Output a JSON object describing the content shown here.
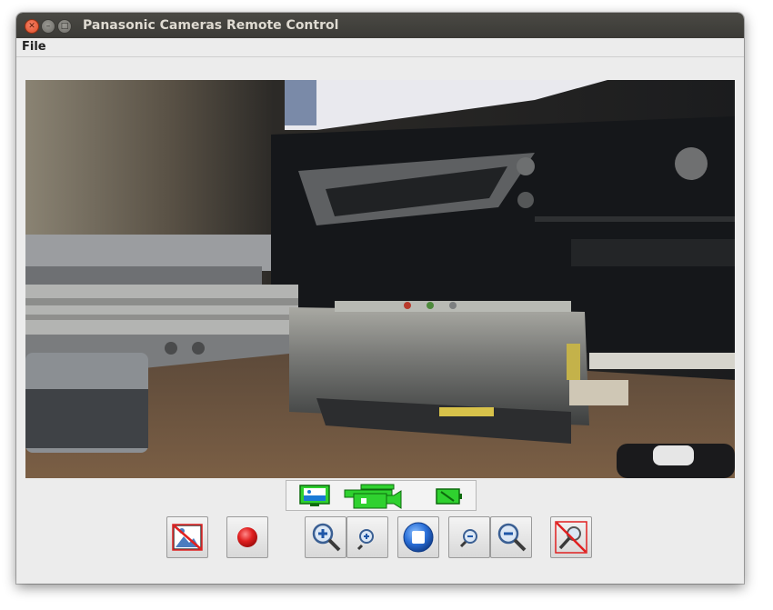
{
  "window": {
    "title": "Panasonic Cameras Remote Control"
  },
  "menu": {
    "file_label": "File"
  },
  "colors": {
    "accent_green": "#2fd12f",
    "record_red": "#e02020",
    "stop_blue": "#2a6fd8"
  },
  "mode_bar": {
    "icons": [
      "picture-mode-icon",
      "video-camera-mode-icon",
      "battery-icon"
    ]
  },
  "toolbar": {
    "icons": [
      "no-picture-icon",
      "record-icon",
      "zoom-in-large-icon",
      "zoom-in-small-icon",
      "stop-icon",
      "zoom-out-small-icon",
      "zoom-out-large-icon",
      "no-zoom-icon"
    ]
  }
}
